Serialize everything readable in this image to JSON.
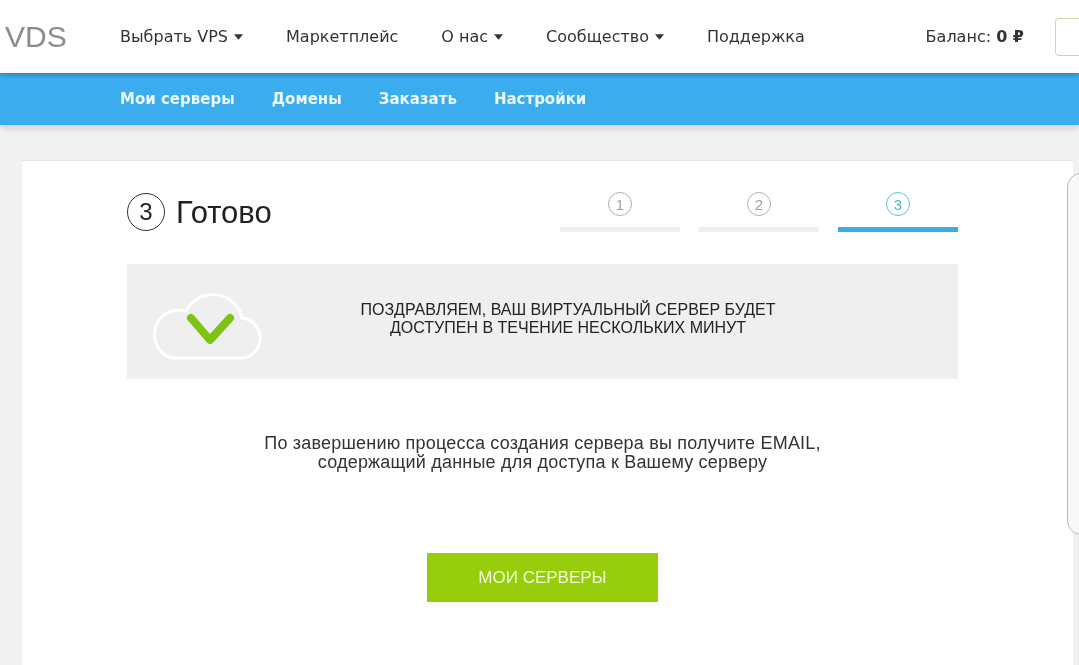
{
  "header": {
    "logo": "VDS",
    "nav": [
      {
        "label": "Выбрать VPS",
        "has_menu": true
      },
      {
        "label": "Маркетплейс",
        "has_menu": false
      },
      {
        "label": "О нас",
        "has_menu": true
      },
      {
        "label": "Сообщество",
        "has_menu": true
      },
      {
        "label": "Поддержка",
        "has_menu": false
      }
    ],
    "balance": "Баланс: **0 ₽**"
  },
  "subnav": [
    "Мои серверы",
    "Домены",
    "Заказать",
    "Настройки"
  ],
  "wizard": {
    "step_number": "3",
    "title": "Готово",
    "steps": [
      {
        "number": "1",
        "selected": false
      },
      {
        "number": "2",
        "selected": false
      },
      {
        "number": "3",
        "selected": true
      }
    ],
    "success_banner": {
      "lines": [
        "ПОЗДРАВЛЯЕМ, ВАШ ВИРТУАЛЬНЫЙ СЕРВЕР БУДЕТ",
        "ДОСТУПЕН В ТЕЧЕНИЕ НЕСКОЛЬКИХ МИНУТ"
      ]
    },
    "message": {
      "lines": [
        "По завершению процесса создания сервера вы получите EMAIL,",
        "содержащий данные для доступа к Вашему серверу"
      ]
    },
    "button": "МОИ СЕРВЕРЫ"
  }
}
